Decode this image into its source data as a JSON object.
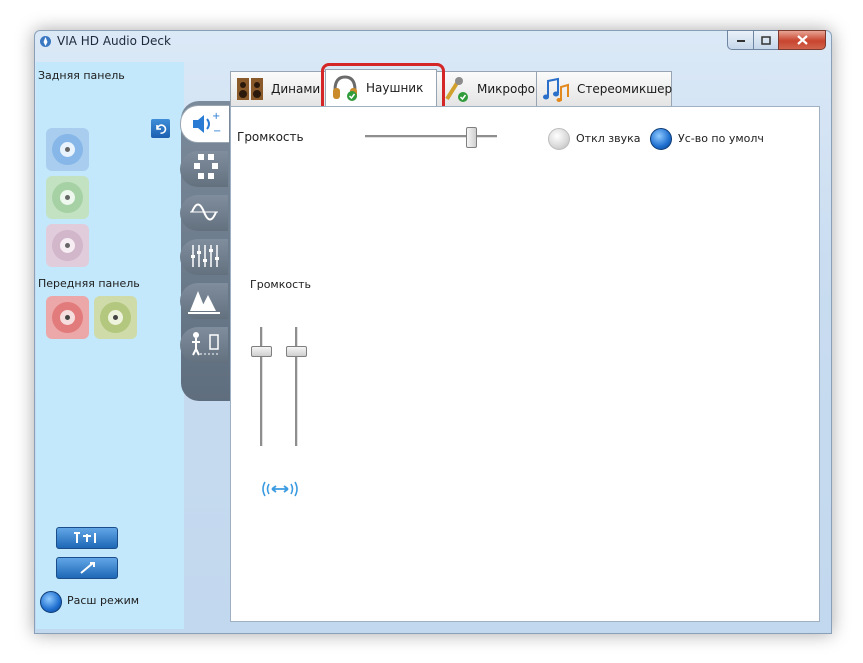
{
  "window": {
    "title": "VIA HD Audio Deck"
  },
  "sidebar": {
    "rear_panel_label": "Задняя панель",
    "front_panel_label": "Передняя панель",
    "advanced_mode_label": "Расш режим",
    "rear_jacks": [
      {
        "color": "#9fc4ea",
        "name": "rear-jack-blue"
      },
      {
        "color": "#b9dcb8",
        "name": "rear-jack-green"
      },
      {
        "color": "#dcc6d6",
        "name": "rear-jack-pink"
      }
    ],
    "front_jacks": [
      {
        "color": "#e8a9a9",
        "name": "front-jack-pink"
      },
      {
        "color": "#c8d8a8",
        "name": "front-jack-green"
      }
    ]
  },
  "tabs": [
    {
      "label": "Динамик",
      "icon": "speakers-icon",
      "active": false
    },
    {
      "label": "Наушник",
      "icon": "headphones-icon",
      "active": true
    },
    {
      "label": "Микрофон",
      "icon": "microphone-icon",
      "active": false
    },
    {
      "label": "Стереомикшер",
      "icon": "stereo-mixer-icon",
      "active": false
    }
  ],
  "main": {
    "volume_label": "Громкость",
    "master_volume": 0.8,
    "mute_label": "Откл звука",
    "mute_on": false,
    "default_device_label": "Ус-во по умолч",
    "default_device_on": true,
    "channel_volume_label": "Громкость",
    "channel_left_volume": 0.8,
    "channel_right_volume": 0.8
  },
  "colors": {
    "sidebar_bg": "#c3e8fb",
    "accent": "#1f6fd0",
    "highlight": "#d42626"
  }
}
